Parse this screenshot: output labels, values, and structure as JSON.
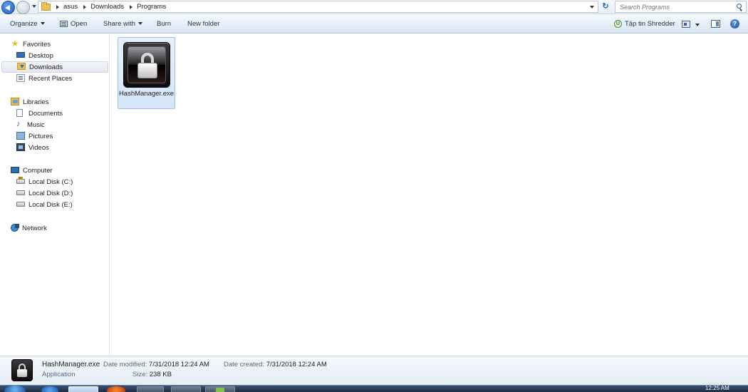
{
  "address_bar": {
    "breadcrumbs": [
      "asus",
      "Downloads",
      "Programs"
    ],
    "search_placeholder": "Search Programs"
  },
  "toolbar": {
    "organize": "Organize",
    "open": "Open",
    "share_with": "Share with",
    "burn": "Burn",
    "new_folder": "New folder",
    "shredder": "Tập tin Shredder"
  },
  "nav": {
    "favorites": "Favorites",
    "desktop": "Desktop",
    "downloads": "Downloads",
    "recent_places": "Recent Places",
    "libraries": "Libraries",
    "documents": "Documents",
    "music": "Music",
    "pictures": "Pictures",
    "videos": "Videos",
    "computer": "Computer",
    "disk_c": "Local Disk (C:)",
    "disk_d": "Local Disk (D:)",
    "disk_e": "Local Disk (E:)",
    "network": "Network"
  },
  "files": [
    {
      "name": "HashManager.exe",
      "icon": "padlock-icon"
    }
  ],
  "details": {
    "name": "HashManager.exe",
    "type": "Application",
    "date_modified_label": "Date modified:",
    "date_modified": "7/31/2018 12:24 AM",
    "size_label": "Size:",
    "size": "238 KB",
    "date_created_label": "Date created:",
    "date_created": "7/31/2018 12:24 AM"
  },
  "taskbar": {
    "clock": "12:25 AM"
  },
  "colors": {
    "selection": "#dbe9fb",
    "toolbar": "#e3ecf7",
    "accent": "#1f5fb8"
  }
}
